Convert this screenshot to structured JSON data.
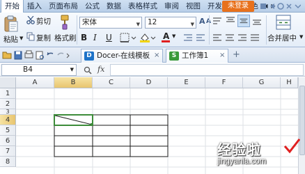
{
  "menubar": {
    "items": [
      "开始",
      "插入",
      "页面布局",
      "公式",
      "数据",
      "表格样式",
      "审阅",
      "视图",
      "开发工具",
      "特色"
    ],
    "login_label": "未登录"
  },
  "ribbon": {
    "paste_label": "粘贴",
    "cut_label": "剪切",
    "copy_label": "复制",
    "format_painter_label": "格式刷",
    "font_name": "宋体",
    "font_size": "12",
    "bold": "B",
    "italic": "I",
    "underline": "U",
    "font_color_glyph": "A",
    "grow_font": "A",
    "shrink_font": "A",
    "merge_label": "合并居中"
  },
  "tabs": [
    {
      "label": "Docer-在线模板",
      "icon_color": "#1e73c8",
      "icon_glyph": "D"
    },
    {
      "label": "工作簿1",
      "icon_color": "#3a9a3a",
      "icon_glyph": "S"
    }
  ],
  "formula_bar": {
    "name_box": "B4",
    "fx_label": "fx",
    "value": ""
  },
  "sheet": {
    "columns": [
      "A",
      "B",
      "C",
      "D",
      "E",
      "F",
      "G",
      "H"
    ],
    "rows": [
      "1",
      "2",
      "3",
      "4",
      "5",
      "6",
      "7",
      "8"
    ],
    "selected_cell": "B4"
  },
  "watermark": {
    "title": "经验啦",
    "url": "jingyanla.com"
  },
  "colors": {
    "accent": "#e8711c",
    "selection": "#3d8c3a"
  }
}
